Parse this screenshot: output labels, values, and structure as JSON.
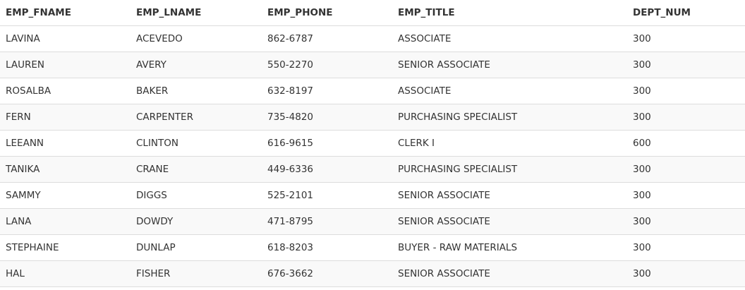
{
  "table": {
    "columns": [
      "EMP_FNAME",
      "EMP_LNAME",
      "EMP_PHONE",
      "EMP_TITLE",
      "DEPT_NUM"
    ],
    "rows": [
      [
        "LAVINA",
        "ACEVEDO",
        "862-6787",
        "ASSOCIATE",
        "300"
      ],
      [
        "LAUREN",
        "AVERY",
        "550-2270",
        "SENIOR ASSOCIATE",
        "300"
      ],
      [
        "ROSALBA",
        "BAKER",
        "632-8197",
        "ASSOCIATE",
        "300"
      ],
      [
        "FERN",
        "CARPENTER",
        "735-4820",
        "PURCHASING SPECIALIST",
        "300"
      ],
      [
        "LEEANN",
        "CLINTON",
        "616-9615",
        "CLERK I",
        "600"
      ],
      [
        "TANIKA",
        "CRANE",
        "449-6336",
        "PURCHASING SPECIALIST",
        "300"
      ],
      [
        "SAMMY",
        "DIGGS",
        "525-2101",
        "SENIOR ASSOCIATE",
        "300"
      ],
      [
        "LANA",
        "DOWDY",
        "471-8795",
        "SENIOR ASSOCIATE",
        "300"
      ],
      [
        "STEPHAINE",
        "DUNLAP",
        "618-8203",
        "BUYER - RAW MATERIALS",
        "300"
      ],
      [
        "HAL",
        "FISHER",
        "676-3662",
        "SENIOR ASSOCIATE",
        "300"
      ]
    ]
  }
}
